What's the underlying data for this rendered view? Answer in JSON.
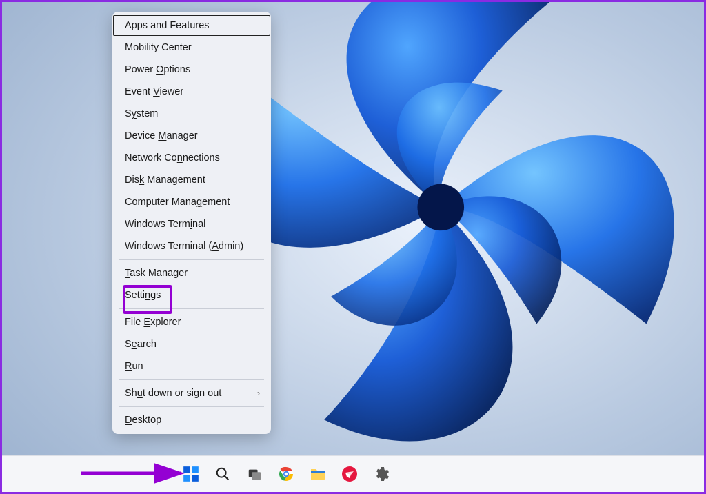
{
  "annotations": {
    "highlight_target": "settings",
    "arrow_target": "start-button"
  },
  "menu": {
    "groups": [
      [
        {
          "key": "apps-features",
          "pre": "Apps and ",
          "acc": "F",
          "post": "eatures",
          "selected": true
        },
        {
          "key": "mobility-center",
          "pre": "Mobility Cente",
          "acc": "r",
          "post": ""
        },
        {
          "key": "power-options",
          "pre": "Power ",
          "acc": "O",
          "post": "ptions"
        },
        {
          "key": "event-viewer",
          "pre": "Event ",
          "acc": "V",
          "post": "iewer"
        },
        {
          "key": "system",
          "pre": "S",
          "acc": "y",
          "post": "stem"
        },
        {
          "key": "device-manager",
          "pre": "Device ",
          "acc": "M",
          "post": "anager"
        },
        {
          "key": "network-connections",
          "pre": "Network Co",
          "acc": "n",
          "post": "nections"
        },
        {
          "key": "disk-management",
          "pre": "Dis",
          "acc": "k",
          "post": " Management"
        },
        {
          "key": "computer-management",
          "pre": "Computer Mana",
          "acc": "g",
          "post": "ement"
        },
        {
          "key": "windows-terminal",
          "pre": "Windows Term",
          "acc": "i",
          "post": "nal"
        },
        {
          "key": "windows-terminal-admin",
          "pre": "Windows Terminal (",
          "acc": "A",
          "post": "dmin)"
        }
      ],
      [
        {
          "key": "task-manager",
          "pre": "",
          "acc": "T",
          "post": "ask Manager"
        },
        {
          "key": "settings",
          "pre": "Setti",
          "acc": "n",
          "post": "gs"
        }
      ],
      [
        {
          "key": "file-explorer",
          "pre": "File ",
          "acc": "E",
          "post": "xplorer"
        },
        {
          "key": "search",
          "pre": "S",
          "acc": "e",
          "post": "arch"
        },
        {
          "key": "run",
          "pre": "",
          "acc": "R",
          "post": "un"
        }
      ],
      [
        {
          "key": "shutdown",
          "pre": "Sh",
          "acc": "u",
          "post": "t down or sign out",
          "submenu": true
        }
      ],
      [
        {
          "key": "desktop",
          "pre": "",
          "acc": "D",
          "post": "esktop"
        }
      ]
    ]
  },
  "taskbar": {
    "items": [
      {
        "key": "start",
        "icon": "start-icon"
      },
      {
        "key": "search",
        "icon": "search-icon"
      },
      {
        "key": "taskview",
        "icon": "taskview-icon"
      },
      {
        "key": "chrome",
        "icon": "chrome-icon"
      },
      {
        "key": "explorer",
        "icon": "explorer-icon"
      },
      {
        "key": "mail",
        "icon": "mail-icon"
      },
      {
        "key": "settings",
        "icon": "gear-icon"
      }
    ]
  }
}
